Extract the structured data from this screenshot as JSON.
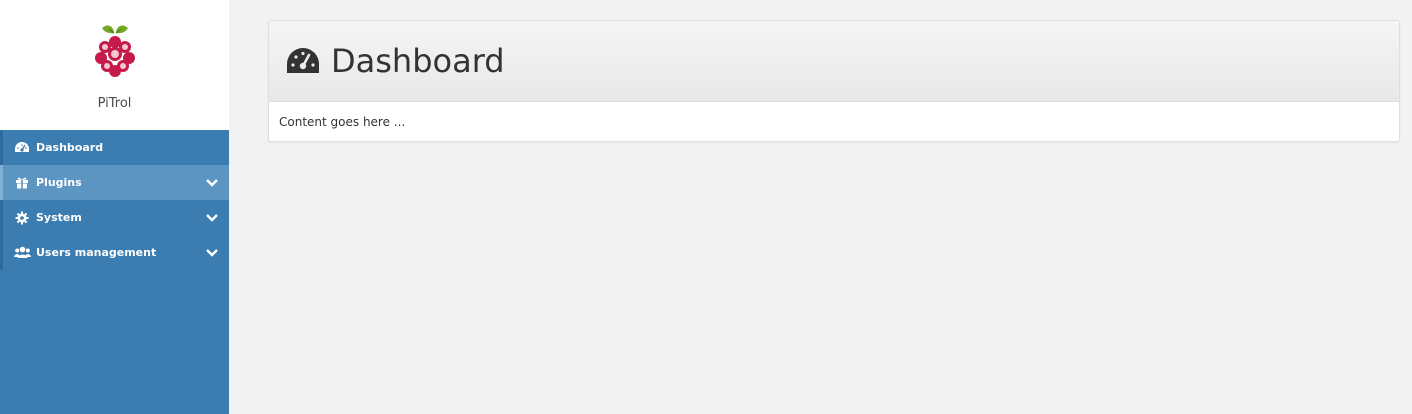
{
  "brand": {
    "name": "PiTrol"
  },
  "sidebar": {
    "items": [
      {
        "label": "Dashboard",
        "icon": "dashboard-icon",
        "expandable": false
      },
      {
        "label": "Plugins",
        "icon": "gift-icon",
        "expandable": true
      },
      {
        "label": "System",
        "icon": "gear-icon",
        "expandable": true
      },
      {
        "label": "Users management",
        "icon": "users-icon",
        "expandable": true
      }
    ]
  },
  "main": {
    "title": "Dashboard",
    "body": "Content goes here ..."
  },
  "colors": {
    "sidebar": "#3b7db1",
    "sidebar_hover": "#5c94c2",
    "background": "#f2f2f2",
    "panel_header": "#ececec"
  }
}
